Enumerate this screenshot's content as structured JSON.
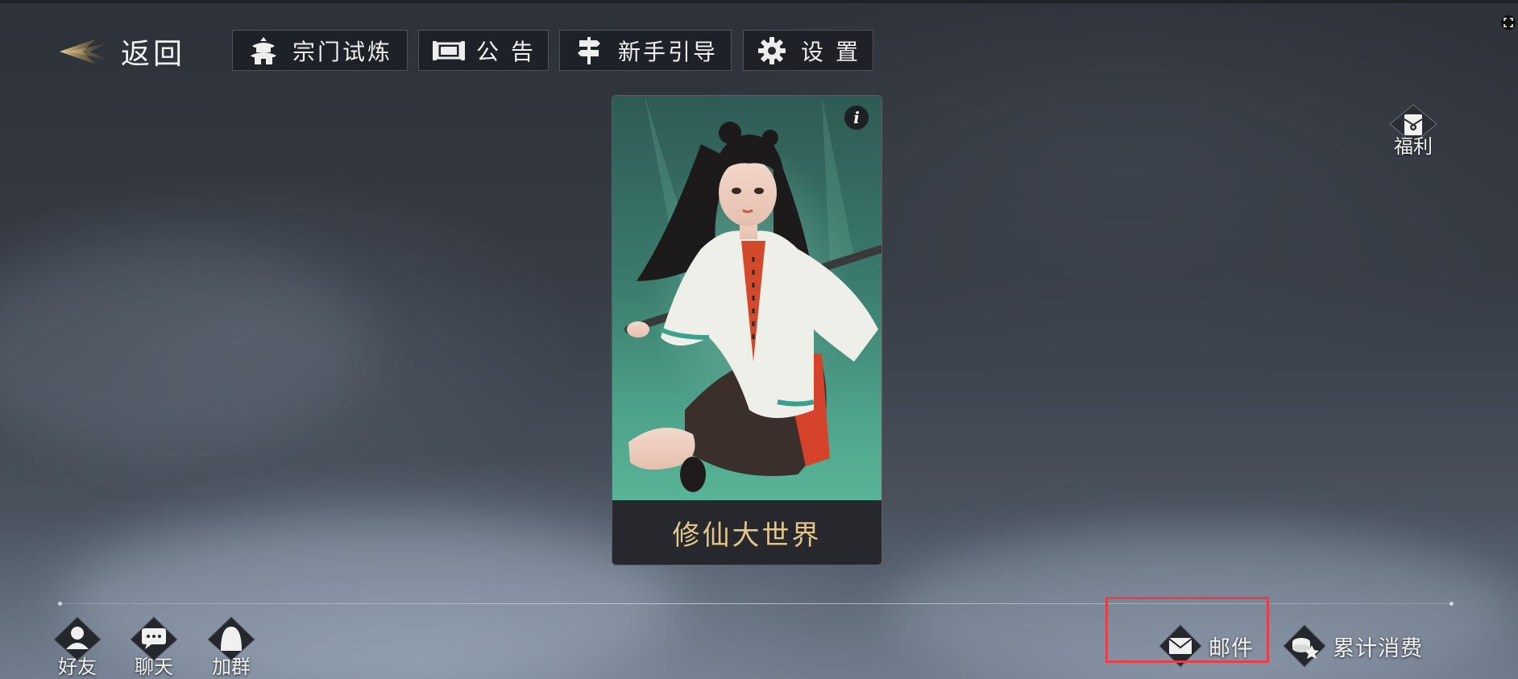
{
  "top_bar": {
    "back_label": "返回",
    "buttons": [
      {
        "label": "宗门试炼",
        "icon": "pagoda-icon"
      },
      {
        "label": "公 告",
        "icon": "scroll-icon"
      },
      {
        "label": "新手引导",
        "icon": "signpost-icon"
      },
      {
        "label": "设 置",
        "icon": "gear-icon"
      }
    ]
  },
  "welfare": {
    "label": "福利",
    "icon": "red-envelope-icon"
  },
  "card": {
    "title": "修仙大世界",
    "info_glyph": "i"
  },
  "social": [
    {
      "label": "好友",
      "icon": "friend-icon"
    },
    {
      "label": "聊天",
      "icon": "chat-icon"
    },
    {
      "label": "加群",
      "icon": "group-icon"
    }
  ],
  "bottom_right": {
    "mail_label": "邮件",
    "spend_label": "累计消费"
  },
  "colors": {
    "card_title": "#e3c58a",
    "highlight": "#e5404a",
    "back_arrow": "#d8b872"
  }
}
